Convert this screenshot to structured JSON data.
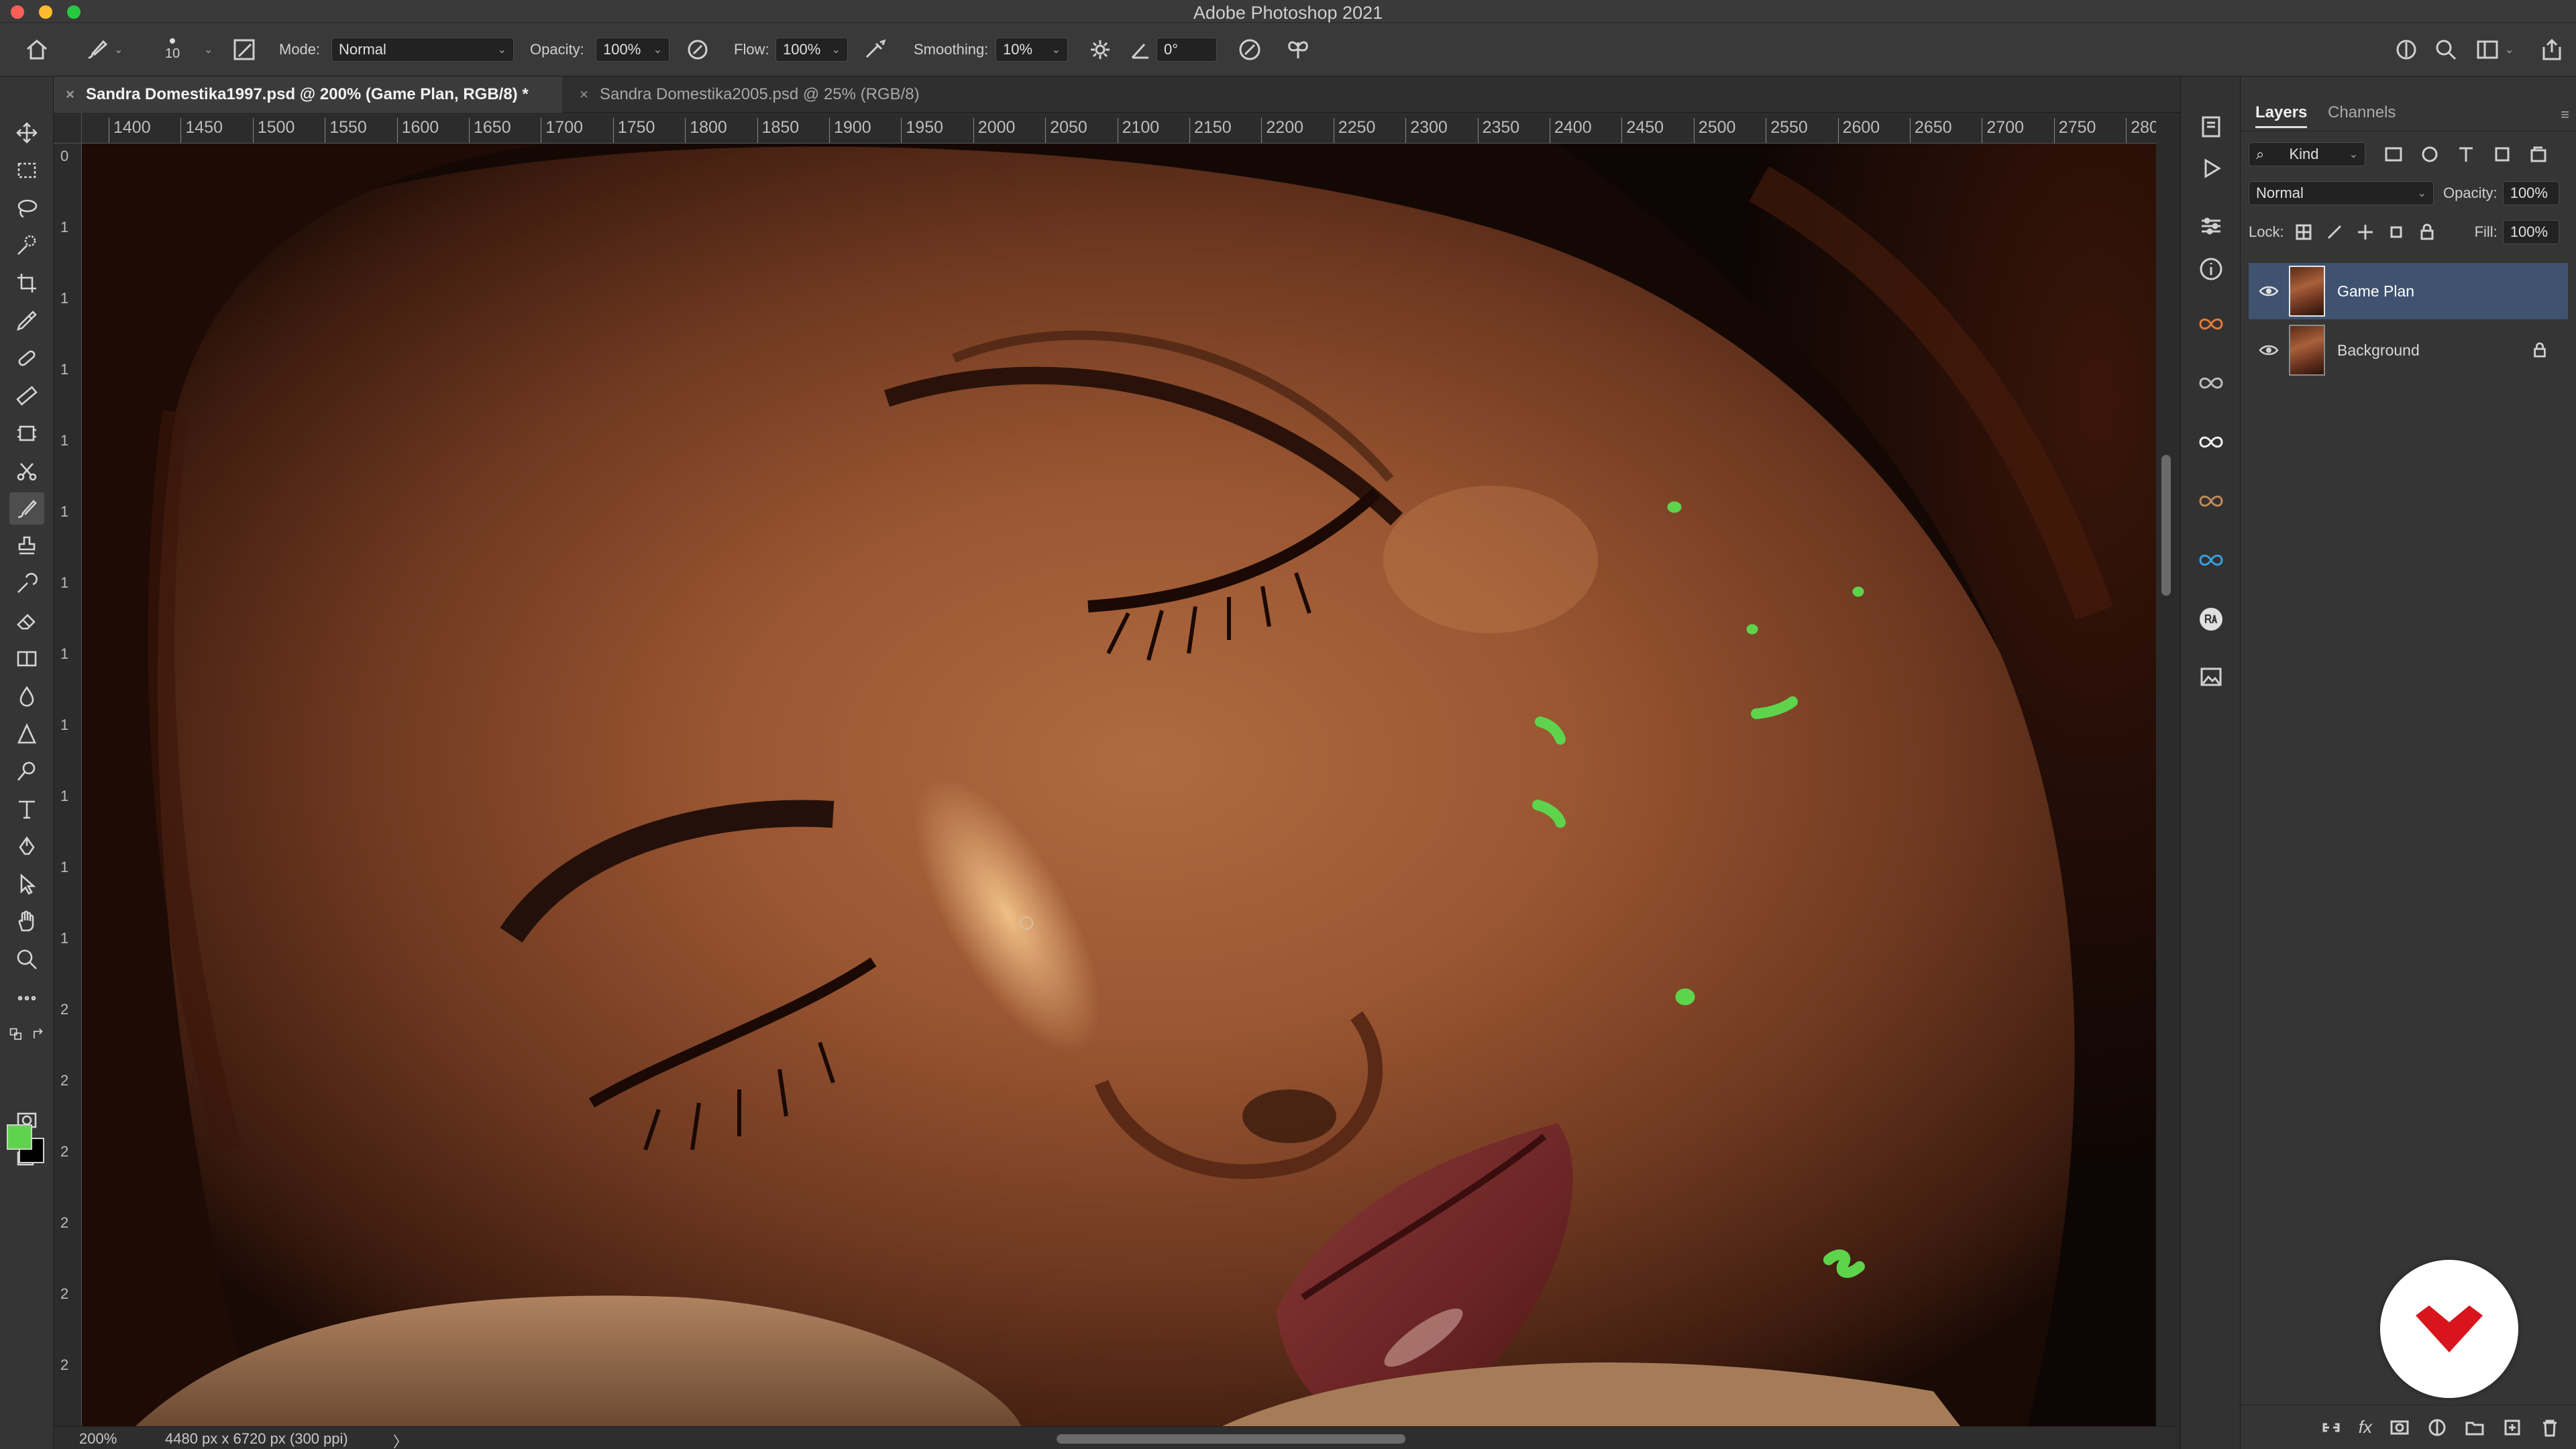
{
  "app": {
    "title": "Adobe Photoshop 2021"
  },
  "options": {
    "brush_size": "10",
    "mode_label": "Mode:",
    "mode_value": "Normal",
    "opacity_label": "Opacity:",
    "opacity_value": "100%",
    "flow_label": "Flow:",
    "flow_value": "100%",
    "smoothing_label": "Smoothing:",
    "smoothing_value": "10%",
    "angle_value": "0°"
  },
  "tabs": [
    {
      "label": "Sandra Domestika1997.psd @ 200% (Game Plan, RGB/8) *",
      "active": true
    },
    {
      "label": "Sandra Domestika2005.psd @ 25% (RGB/8)",
      "active": false
    }
  ],
  "ruler": {
    "top": [
      "1400",
      "1450",
      "1500",
      "1550",
      "1600",
      "1650",
      "1700",
      "1750",
      "1800",
      "1850",
      "1900",
      "1950",
      "2000",
      "2050",
      "2100",
      "2150",
      "2200",
      "2250",
      "2300",
      "2350",
      "2400",
      "2450",
      "2500",
      "2550",
      "2600",
      "2650",
      "2700",
      "2750",
      "280"
    ],
    "left": [
      "0",
      "1",
      "1",
      "1",
      "1",
      "1",
      "1",
      "1",
      "1",
      "1",
      "1",
      "1",
      "2",
      "2",
      "2",
      "2",
      "2",
      "2",
      "2"
    ]
  },
  "tools": [
    "move-tool",
    "marquee-tool",
    "lasso-tool",
    "quick-select-tool",
    "crop-tool",
    "eyedropper-tool",
    "healing-tool",
    "brush-tool",
    "clone-stamp-tool",
    "history-brush-tool",
    "eraser-tool",
    "gradient-tool",
    "blur-tool",
    "dodge-tool",
    "pen-tool",
    "type-tool",
    "path-select-tool",
    "rectangle-tool",
    "hand-tool",
    "zoom-tool",
    "more-tools"
  ],
  "colors": {
    "foreground": "#5ed44c",
    "background": "#000000",
    "selected_layer": "#3f5270"
  },
  "status": {
    "zoom": "200%",
    "doc_info": "4480 px x 6720 px (300 ppi)",
    "more": "〉"
  },
  "layers_panel": {
    "tab_layers": "Layers",
    "tab_channels": "Channels",
    "filter_kind": "Kind",
    "blend_mode": "Normal",
    "opacity_label": "Opacity:",
    "opacity_value": "100%",
    "lock_label": "Lock:",
    "fill_label": "Fill:",
    "fill_value": "100%",
    "layers": [
      {
        "name": "Game Plan",
        "selected": true,
        "locked": false
      },
      {
        "name": "Background",
        "selected": false,
        "locked": true
      }
    ]
  }
}
